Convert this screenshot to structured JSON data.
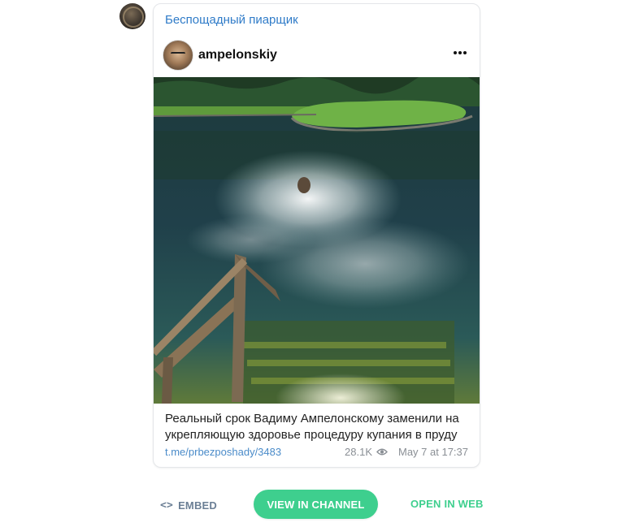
{
  "channel": {
    "name": "Беспощадный пиарщик",
    "avatar_icon": "channel-avatar"
  },
  "post": {
    "author": "ampelonskiy",
    "more_icon": "more-dots-icon",
    "caption": "Реальный срок Вадиму Ампелонскому заменили на укрепляющую здоровье процедуру купания в пруду",
    "link": "t.me/prbezposhady/3483",
    "views": "28.1K",
    "date": "May 7 at 17:37"
  },
  "actions": {
    "embed_icon": "<>",
    "embed_label": "EMBED",
    "view_channel_label": "VIEW IN CHANNEL",
    "open_web_label": "OPEN IN WEB"
  },
  "colors": {
    "link": "#2f7bc8",
    "accent": "#3ecf8e",
    "muted": "#8a8f95"
  }
}
